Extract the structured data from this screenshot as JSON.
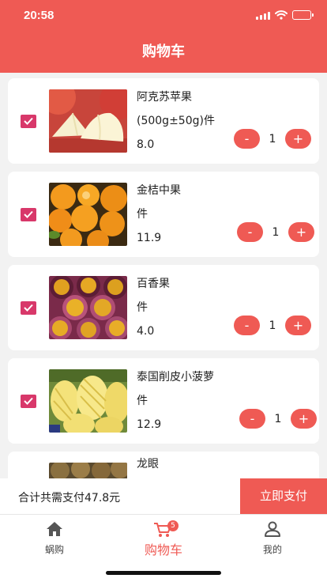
{
  "status_bar": {
    "time": "20:58"
  },
  "header": {
    "title": "购物车"
  },
  "cart_items": [
    {
      "name": "阿克苏苹果",
      "spec": "(500g±50g)件",
      "price": "8.0",
      "quantity": "1",
      "checked": true,
      "image": "apple"
    },
    {
      "name": "金桔中果",
      "spec": "件",
      "price": "11.9",
      "quantity": "1",
      "checked": true,
      "image": "kumquat"
    },
    {
      "name": "百香果",
      "spec": "件",
      "price": "4.0",
      "quantity": "1",
      "checked": true,
      "image": "passion-fruit"
    },
    {
      "name": "泰国削皮小菠萝",
      "spec": "件",
      "price": "12.9",
      "quantity": "1",
      "checked": true,
      "image": "pineapple"
    },
    {
      "name": "龙眼",
      "image": "longan"
    }
  ],
  "stepper": {
    "minus": "-",
    "plus": "+"
  },
  "checkout": {
    "total_text": "合计共需支付47.8元",
    "pay_label": "立即支付"
  },
  "tabbar": [
    {
      "label": "蜗购",
      "icon": "home-icon",
      "active": false
    },
    {
      "label": "购物车",
      "icon": "cart-icon",
      "active": true,
      "badge": "5"
    },
    {
      "label": "我的",
      "icon": "user-icon",
      "active": false
    }
  ],
  "colors": {
    "primary": "#ef5a54",
    "checkbox": "#d8386a",
    "background": "#f2f2f2"
  }
}
